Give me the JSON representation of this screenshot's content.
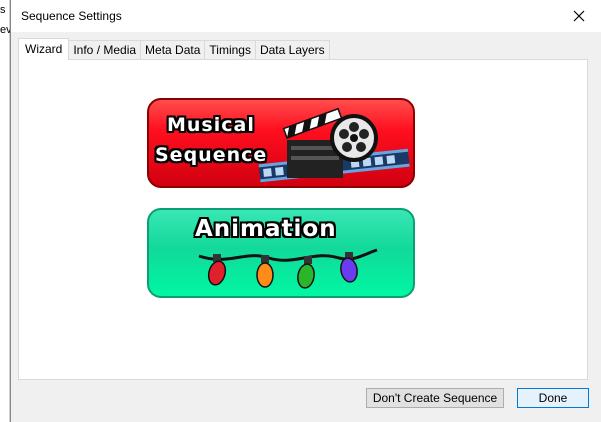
{
  "background_window": {
    "lines": [
      "s",
      "ev"
    ]
  },
  "window": {
    "title": "Sequence Settings"
  },
  "tabs": [
    {
      "label": "Wizard",
      "active": true
    },
    {
      "label": "Info / Media",
      "active": false
    },
    {
      "label": "Meta Data",
      "active": false
    },
    {
      "label": "Timings",
      "active": false
    },
    {
      "label": "Data Layers",
      "active": false
    }
  ],
  "wizard": {
    "musical": {
      "line1": "Musical",
      "line2": "Sequence",
      "icon": "film-clapper-reel-icon",
      "color": "#ff1020"
    },
    "animation": {
      "line1": "Animation",
      "icon": "christmas-lights-icon",
      "color": "#10e6a0"
    }
  },
  "footer": {
    "dont_create_label": "Don't Create Sequence",
    "done_label": "Done"
  }
}
